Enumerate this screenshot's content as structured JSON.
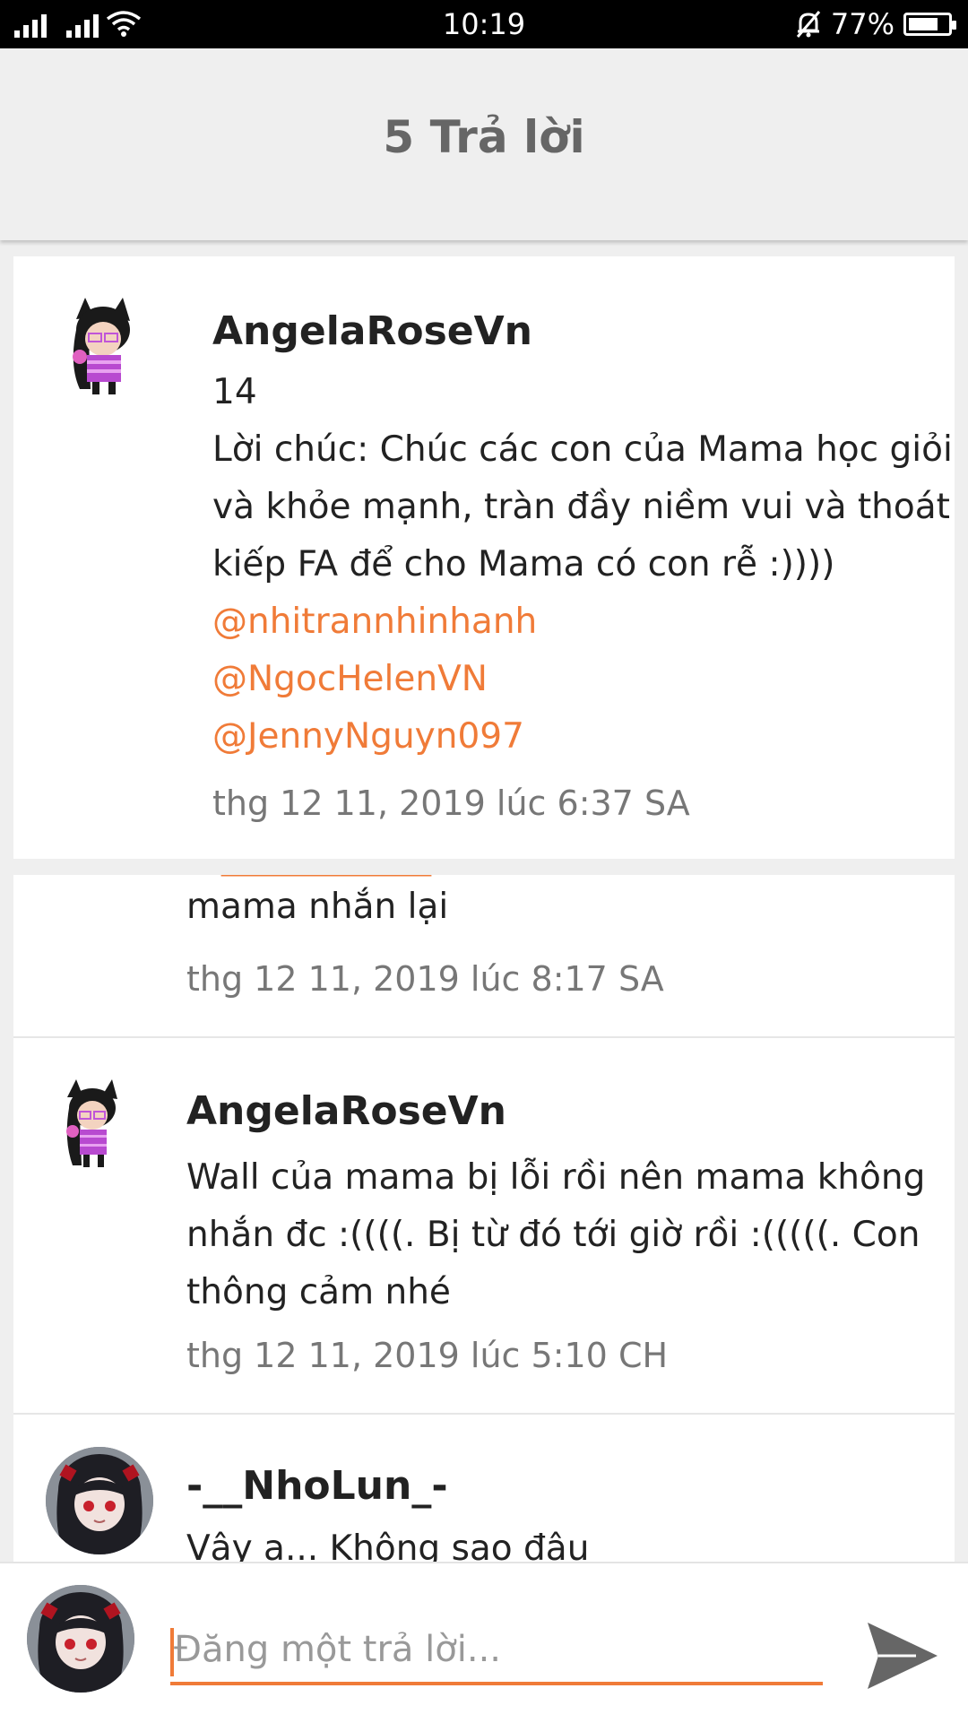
{
  "status_bar": {
    "time": "10:19",
    "battery": "77%",
    "battery_level": 0.77
  },
  "header": {
    "title": "5 Trả lời"
  },
  "original_post": {
    "author": "AngelaRoseVn",
    "number": "14",
    "lines": [
      "Lời chúc: Chúc các con của Mama học giỏi",
      "và khỏe mạnh, tràn đầy niềm vui và thoát",
      "kiếp FA để cho Mama có con rễ :))))"
    ],
    "mentions": [
      "@nhitrannhinhanh",
      "@NgocHelenVN",
      "@JennyNguyn097"
    ],
    "timestamp": "thg 12 11, 2019 lúc 6:37 SA"
  },
  "replies": [
    {
      "author": "",
      "lines": [
        "mama nhắn lại"
      ],
      "timestamp": "thg 12 11, 2019 lúc 8:17 SA"
    },
    {
      "author": "AngelaRoseVn",
      "lines": [
        "Wall của mama bị lỗi rồi nên mama không",
        "nhắn đc :((((. Bị từ đó tới giờ rồi :(((((. Con",
        "thông cảm nhé"
      ],
      "timestamp": "thg 12 11, 2019 lúc 5:10 CH"
    },
    {
      "author": "-__NhoLun_-",
      "lines": [
        "Vậy ạ... Không sao đâu"
      ],
      "timestamp": ""
    }
  ],
  "composer": {
    "placeholder": "Đăng một trả lời..."
  },
  "icons": {
    "send": "send-icon",
    "wifi": "wifi-icon",
    "mute": "bell-off-icon",
    "battery": "battery-icon"
  },
  "colors": {
    "accent": "#f07b38"
  }
}
